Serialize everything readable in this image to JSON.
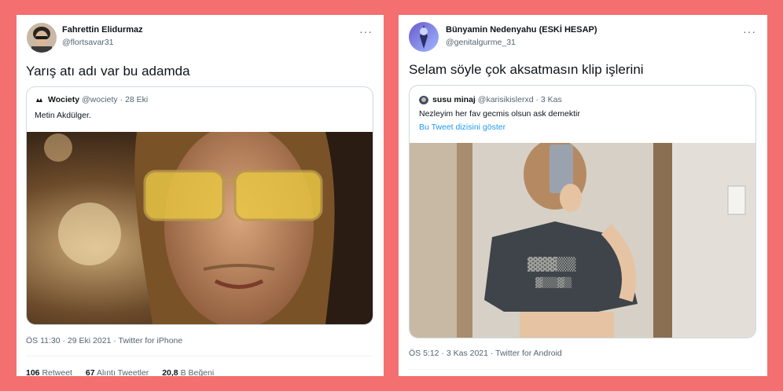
{
  "left_tweet": {
    "author_name": "Fahrettin Elidurmaz",
    "author_handle": "@flortsavar31",
    "text": "Yarış atı adı var bu adamda",
    "quote": {
      "author_name": "Wociety",
      "author_handle": "@wociety",
      "separator": "·",
      "date": "28 Eki",
      "text": "Metin Akdülger."
    },
    "timestamp": "ÖS 11:30 · 29 Eki 2021 · Twitter for iPhone",
    "stats": [
      {
        "count": "106",
        "label": "Retweet"
      },
      {
        "count": "67",
        "label": "Alıntı Tweetler"
      },
      {
        "count": "20,8",
        "label": "B Beğeni"
      }
    ]
  },
  "right_tweet": {
    "author_name": "Bünyamin Nedenyahu (ESKİ HESAP)",
    "author_handle": "@genitalgurme_31",
    "text": "Selam söyle çok aksatmasın klip işlerini",
    "quote": {
      "author_name": "susu minaj",
      "author_handle": "@karisikislerxd",
      "separator": "·",
      "date": "3 Kas",
      "text": "Nezleyim her fav gecmis olsun ask demektir",
      "thread_link": "Bu Tweet dizisini göster"
    },
    "timestamp": "ÖS 5:12 · 3 Kas 2021 · Twitter for Android"
  },
  "more_glyph": "···",
  "colors": {
    "background": "#f36f70",
    "link": "#1d9bf0",
    "secondary_text": "#536471"
  }
}
